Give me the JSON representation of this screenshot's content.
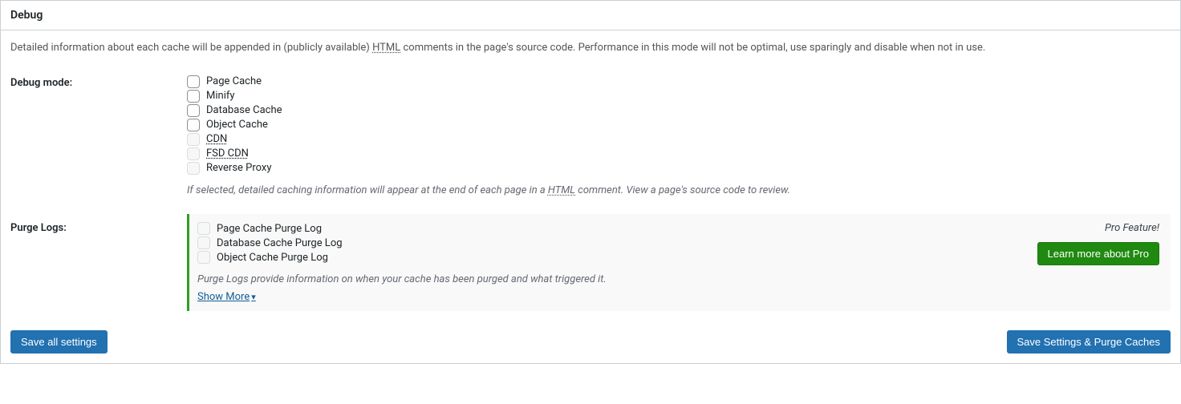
{
  "panel": {
    "title": "Debug",
    "description_pre": "Detailed information about each cache will be appended in (publicly available) ",
    "description_abbr": "HTML",
    "description_post": " comments in the page's source code. Performance in this mode will not be optimal, use sparingly and disable when not in use."
  },
  "debug_mode": {
    "label": "Debug mode:",
    "options": [
      {
        "label": "Page Cache",
        "enabled": true
      },
      {
        "label": "Minify",
        "enabled": true
      },
      {
        "label": "Database Cache",
        "enabled": true
      },
      {
        "label": "Object Cache",
        "enabled": true
      },
      {
        "label": "CDN",
        "enabled": false,
        "dotted": true
      },
      {
        "label": "FSD CDN",
        "enabled": false,
        "dotted": true
      },
      {
        "label": "Reverse Proxy",
        "enabled": false
      }
    ],
    "helper_pre": "If selected, detailed caching information will appear at the end of each page in a ",
    "helper_abbr": "HTML",
    "helper_post": " comment. View a page's source code to review."
  },
  "purge_logs": {
    "label": "Purge Logs:",
    "options": [
      {
        "label": "Page Cache Purge Log"
      },
      {
        "label": "Database Cache Purge Log"
      },
      {
        "label": "Object Cache Purge Log"
      }
    ],
    "helper": "Purge Logs provide information on when your cache has been purged and what triggered it.",
    "show_more": "Show More",
    "pro_badge": "Pro Feature!",
    "pro_button": "Learn more about Pro"
  },
  "buttons": {
    "save_all": "Save all settings",
    "save_purge": "Save Settings & Purge Caches"
  }
}
